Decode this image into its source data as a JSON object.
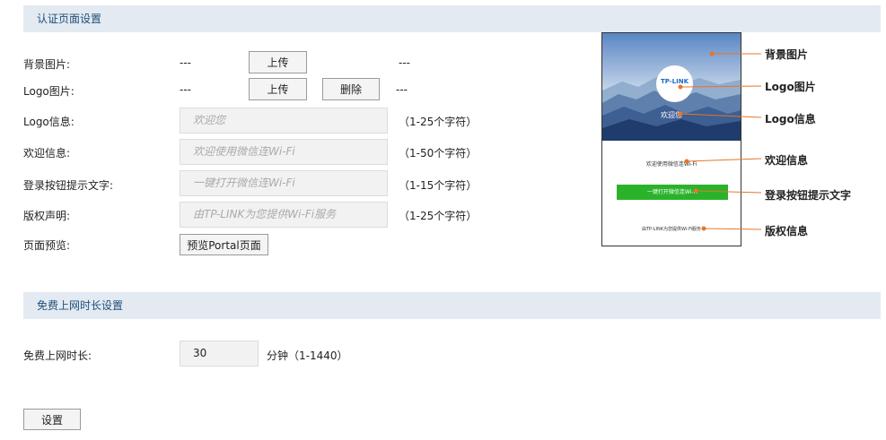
{
  "auth_section": {
    "title": "认证页面设置",
    "bg_image": {
      "label": "背景图片:",
      "value": "---",
      "upload_label": "上传",
      "status": "---"
    },
    "logo_image": {
      "label": "Logo图片:",
      "value": "---",
      "upload_label": "上传",
      "delete_label": "删除",
      "status": "---"
    },
    "logo_info": {
      "label": "Logo信息:",
      "placeholder": "欢迎您",
      "hint": "（1-25个字符）"
    },
    "welcome_info": {
      "label": "欢迎信息:",
      "placeholder": "欢迎使用微信连Wi-Fi",
      "hint": "（1-50个字符）"
    },
    "login_button_text": {
      "label": "登录按钮提示文字:",
      "placeholder": "一键打开微信连Wi-Fi",
      "hint": "（1-15个字符）"
    },
    "copyright": {
      "label": "版权声明:",
      "placeholder": "由TP-LINK为您提供Wi-Fi服务",
      "hint": "（1-25个字符）"
    },
    "preview": {
      "label": "页面预览:",
      "button_label": "预览Portal页面"
    }
  },
  "preview_panel": {
    "logo_text": "TP-LINK",
    "logo_info_text": "欢迎您",
    "welcome_text": "欢迎使用微信连Wi-Fi",
    "button_text": "一键打开微信连Wi-Fi",
    "copyright_text": "由TP-LINK为您提供Wi-Fi服务",
    "button_color": "#2ab32a",
    "callouts": {
      "bg": "背景图片",
      "logo_image": "Logo图片",
      "logo_info": "Logo信息",
      "welcome": "欢迎信息",
      "login_button": "登录按钮提示文字",
      "copyright": "版权信息"
    },
    "callout_color": "#e8742a"
  },
  "free_section": {
    "title": "免费上网时长设置",
    "label": "免费上网时长:",
    "value": "30",
    "unit_hint": "分钟（1-1440）"
  },
  "submit_label": "设置",
  "colors": {
    "section_bg": "#e3eaf2",
    "section_text": "#1f4f78",
    "input_bg": "#f2f2f2"
  }
}
